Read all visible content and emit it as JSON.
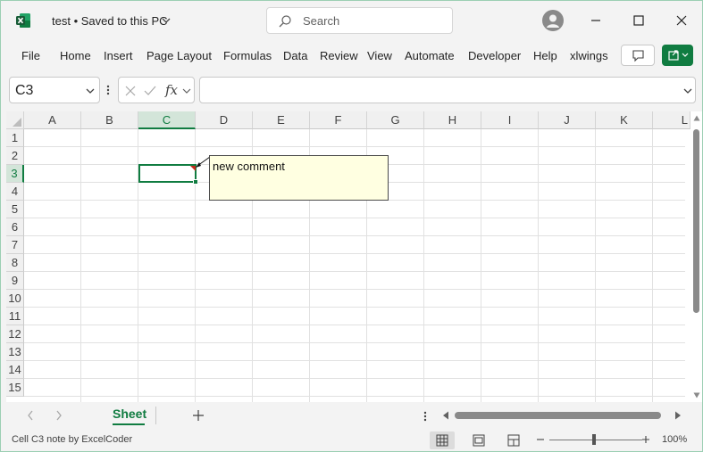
{
  "titlebar": {
    "doc_title": "test • Saved to this PC",
    "search_placeholder": "Search"
  },
  "ribbon": {
    "tabs": [
      "File",
      "Home",
      "Insert",
      "Page Layout",
      "Formulas",
      "Data",
      "Review",
      "View",
      "Automate",
      "Developer",
      "Help",
      "xlwings"
    ]
  },
  "formula_bar": {
    "name_box": "C3",
    "fx_label": "fx",
    "formula_value": ""
  },
  "grid": {
    "columns": [
      "A",
      "B",
      "C",
      "D",
      "E",
      "F",
      "G",
      "H",
      "I",
      "J",
      "K",
      "L"
    ],
    "rows": [
      "1",
      "2",
      "3",
      "4",
      "5",
      "6",
      "7",
      "8",
      "9",
      "10",
      "11",
      "12",
      "13",
      "14",
      "15"
    ],
    "active_column": "C",
    "active_row": "3",
    "comment_text": "new comment"
  },
  "sheets": {
    "active": "Sheet"
  },
  "status": {
    "text": "Cell C3 note by ExcelCoder",
    "zoom": "100%"
  },
  "colors": {
    "accent": "#107c41",
    "note_fill": "#ffffe1",
    "note_indicator": "#c42b1c"
  }
}
